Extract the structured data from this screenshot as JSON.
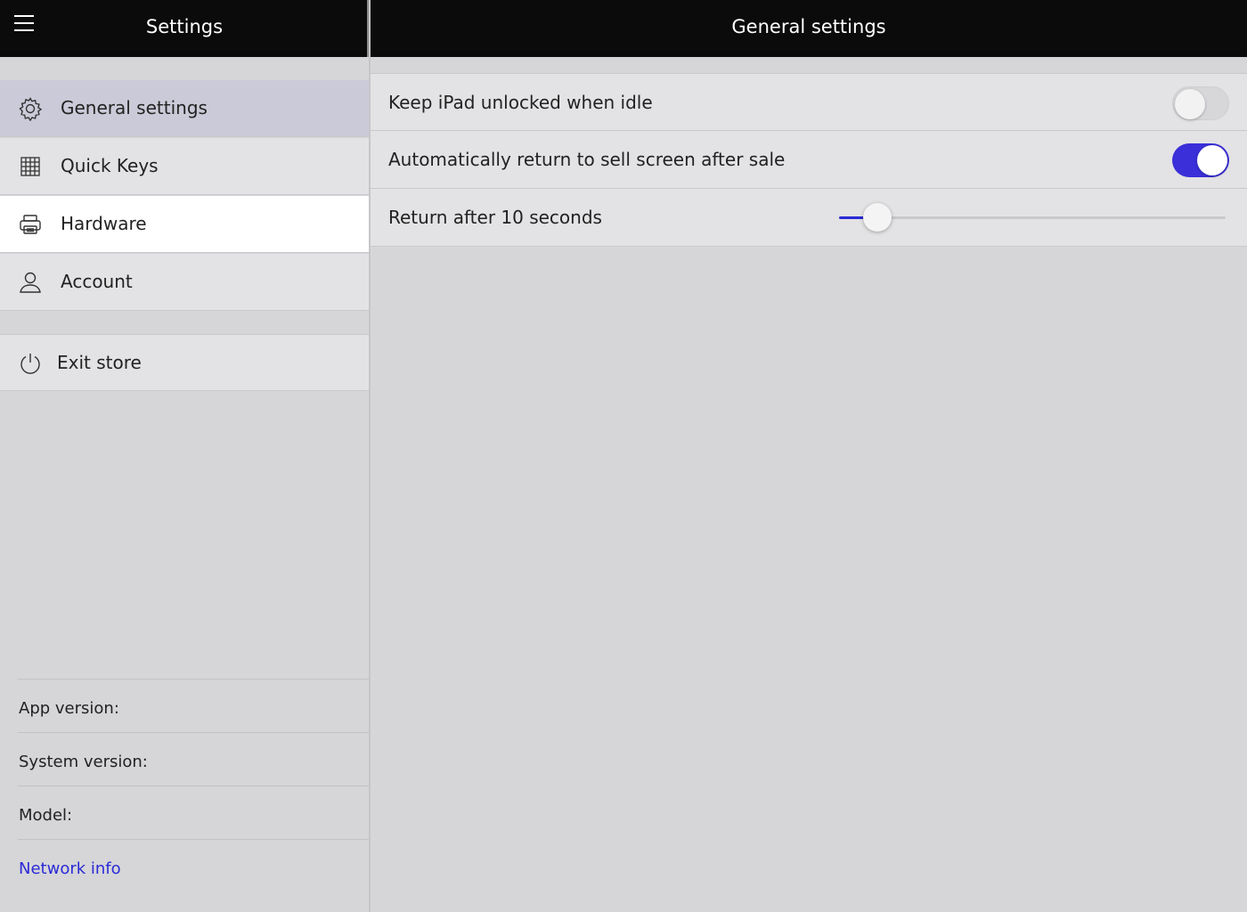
{
  "header": {
    "left_title": "Settings",
    "right_title": "General settings",
    "menu_icon": "hamburger-icon"
  },
  "sidebar": {
    "items": [
      {
        "label": "General settings",
        "icon": "gear-icon",
        "selected": true
      },
      {
        "label": "Quick Keys",
        "icon": "grid-icon"
      },
      {
        "label": "Hardware",
        "icon": "printer-icon"
      },
      {
        "label": "Account",
        "icon": "person-icon"
      }
    ],
    "exit": {
      "label": "Exit store",
      "icon": "power-icon"
    },
    "info": {
      "app_version_label": "App version:",
      "system_version_label": "System version:",
      "model_label": "Model:",
      "network_info_label": "Network info"
    }
  },
  "settings": {
    "keep_unlocked": {
      "label": "Keep iPad unlocked when idle",
      "enabled": false
    },
    "auto_return": {
      "label": "Automatically return to sell screen after sale",
      "enabled": true
    },
    "return_after": {
      "label": "Return after 10 seconds",
      "value_fraction": 0.1
    }
  },
  "colors": {
    "accent": "#3a2fd9",
    "link": "#2a2ad6",
    "selected_row": "#cbcad8"
  }
}
